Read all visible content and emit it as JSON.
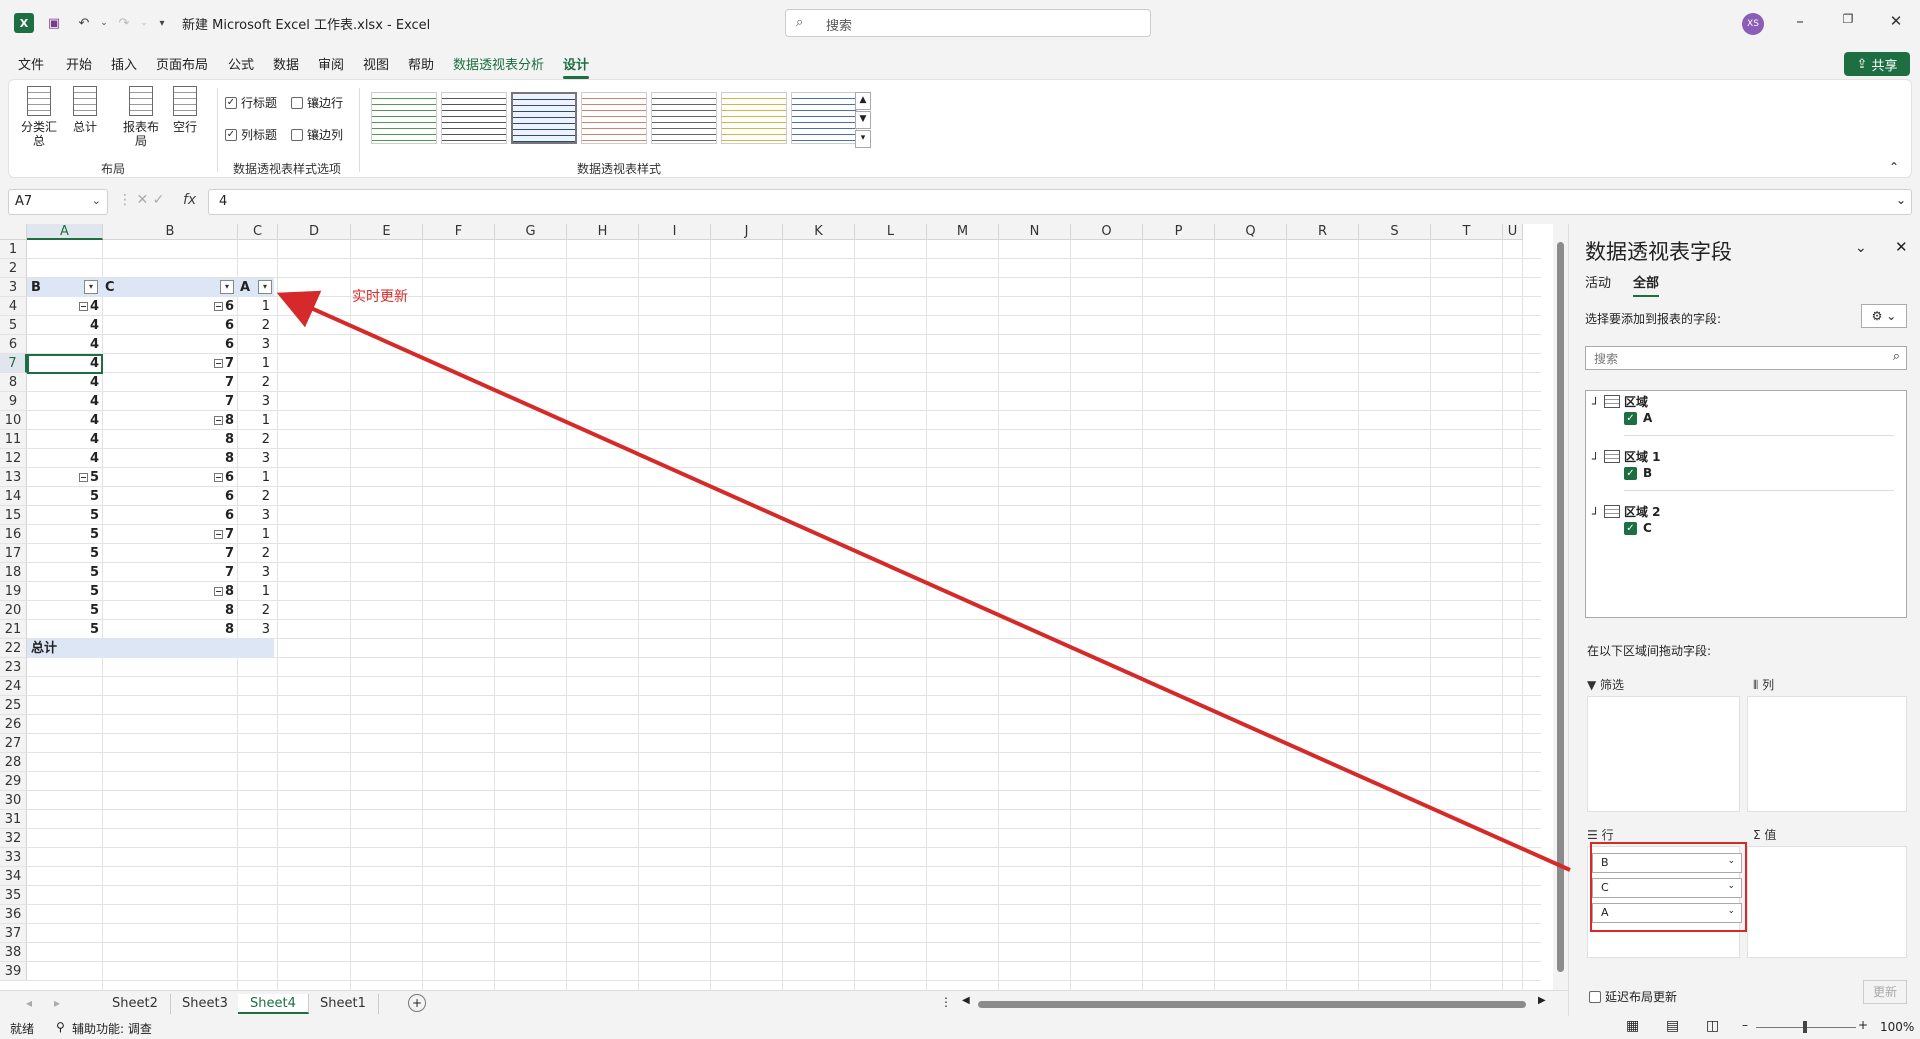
{
  "window": {
    "title": "新建 Microsoft Excel 工作表.xlsx  -  Excel",
    "search_placeholder": "搜索",
    "avatar": "XS"
  },
  "menu": {
    "tabs": [
      "文件",
      "开始",
      "插入",
      "页面布局",
      "公式",
      "数据",
      "审阅",
      "视图",
      "帮助",
      "数据透视表分析",
      "设计"
    ],
    "active": "设计",
    "share": "共享"
  },
  "ribbon": {
    "buttons": {
      "subtotal": "分类汇总",
      "grand_total": "总计",
      "report_layout": "报表布局",
      "blank_rows": "空行"
    },
    "group_layout": "布局",
    "checks": {
      "row_headers": "行标题",
      "banded_rows": "镶边行",
      "col_headers": "列标题",
      "banded_cols": "镶边列"
    },
    "group_options": "数据透视表样式选项",
    "group_styles": "数据透视表样式"
  },
  "formula_bar": {
    "name_box": "A7",
    "fx": "fx",
    "value": "4"
  },
  "columns": [
    "A",
    "B",
    "C",
    "D",
    "E",
    "F",
    "G",
    "H",
    "I",
    "J",
    "K",
    "L",
    "M",
    "N",
    "O",
    "P",
    "Q",
    "R",
    "S",
    "T",
    "U"
  ],
  "rows": [
    "1",
    "2",
    "3",
    "4",
    "5",
    "6",
    "7",
    "8",
    "9",
    "10",
    "11",
    "12",
    "13",
    "14",
    "15",
    "16",
    "17",
    "18",
    "19",
    "20",
    "21",
    "22",
    "23",
    "24",
    "25",
    "26",
    "27",
    "28",
    "29",
    "30",
    "31",
    "32",
    "33",
    "34",
    "35",
    "36",
    "37",
    "38",
    "39"
  ],
  "pivot_table": {
    "headers": [
      "B",
      "C",
      "A"
    ],
    "data": [
      [
        "4",
        "6",
        "1"
      ],
      [
        "4",
        "6",
        "2"
      ],
      [
        "4",
        "6",
        "3"
      ],
      [
        "4",
        "7",
        "1"
      ],
      [
        "4",
        "7",
        "2"
      ],
      [
        "4",
        "7",
        "3"
      ],
      [
        "4",
        "8",
        "1"
      ],
      [
        "4",
        "8",
        "2"
      ],
      [
        "4",
        "8",
        "3"
      ],
      [
        "5",
        "6",
        "1"
      ],
      [
        "5",
        "6",
        "2"
      ],
      [
        "5",
        "6",
        "3"
      ],
      [
        "5",
        "7",
        "1"
      ],
      [
        "5",
        "7",
        "2"
      ],
      [
        "5",
        "7",
        "3"
      ],
      [
        "5",
        "8",
        "1"
      ],
      [
        "5",
        "8",
        "2"
      ],
      [
        "5",
        "8",
        "3"
      ]
    ],
    "total_label": "总计"
  },
  "annotation": "实时更新",
  "sheets": [
    "Sheet2",
    "Sheet3",
    "Sheet4",
    "Sheet1"
  ],
  "active_sheet": "Sheet4",
  "status": {
    "ready": "就绪",
    "accessibility": "辅助功能: 调查",
    "zoom": "100%"
  },
  "pivot_pane": {
    "title": "数据透视表字段",
    "tabs": [
      "活动",
      "全部"
    ],
    "active_tab": "全部",
    "choose_label": "选择要添加到报表的字段:",
    "search_placeholder": "搜索",
    "tables": [
      {
        "name": "区域",
        "field": "A"
      },
      {
        "name": "区域 1",
        "field": "B"
      },
      {
        "name": "区域 2",
        "field": "C"
      }
    ],
    "drag_label": "在以下区域间拖动字段:",
    "areas": {
      "filters": "筛选",
      "columns": "列",
      "rows": "行",
      "values": "值"
    },
    "row_fields": [
      "B",
      "C",
      "A"
    ],
    "defer_label": "延迟布局更新",
    "update_button": "更新"
  },
  "colors": {
    "accent": "#1d6f42",
    "annotation": "#d62a2a"
  }
}
